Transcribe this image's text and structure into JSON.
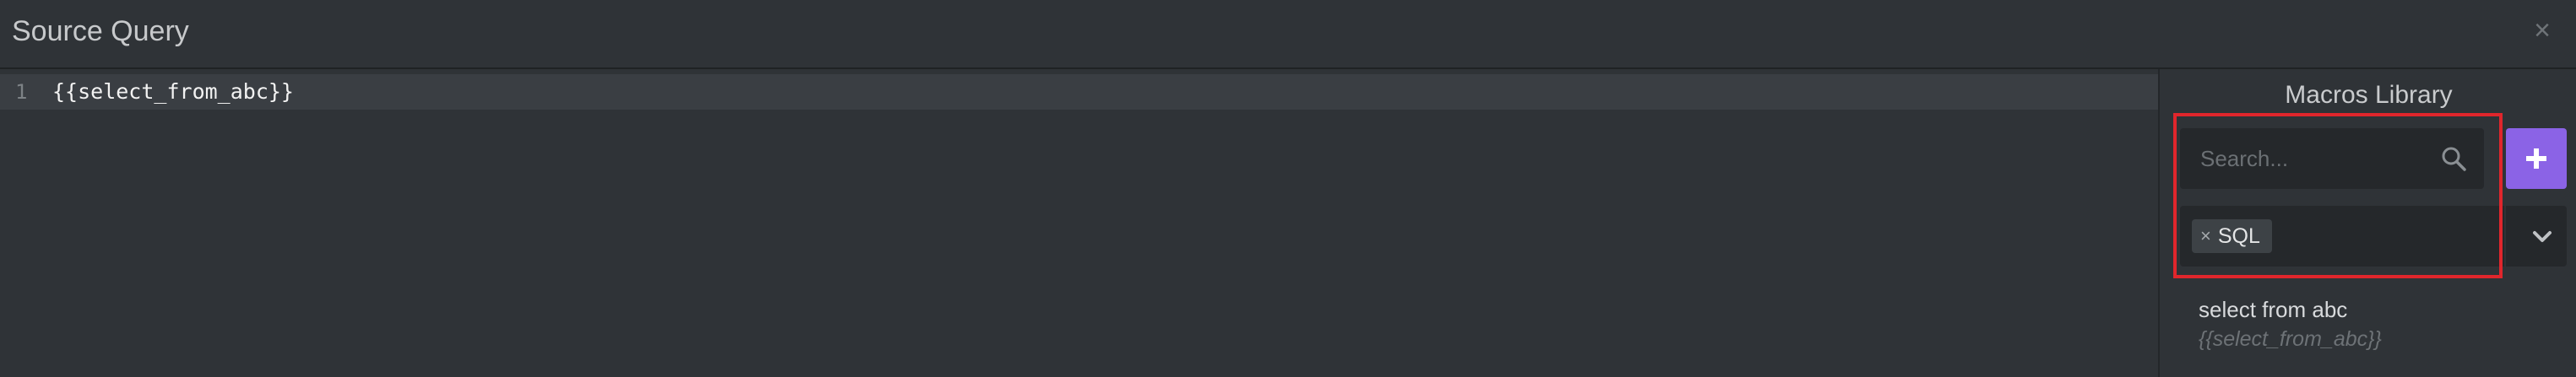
{
  "header": {
    "title": "Source Query",
    "close_label": "×"
  },
  "editor": {
    "line_number": "1",
    "line_code": "{{select_from_abc}}"
  },
  "sidebar": {
    "title": "Macros Library",
    "search": {
      "placeholder": "Search...",
      "value": ""
    },
    "add_button_label": "+",
    "filter": {
      "tags": [
        {
          "remove_label": "×",
          "label": "SQL"
        }
      ]
    },
    "macros": [
      {
        "name": "select from abc",
        "code": "{{select_from_abc}}"
      }
    ]
  },
  "colors": {
    "background": "#2f3337",
    "accent": "#8b63e6",
    "highlight": "#e0262c"
  }
}
